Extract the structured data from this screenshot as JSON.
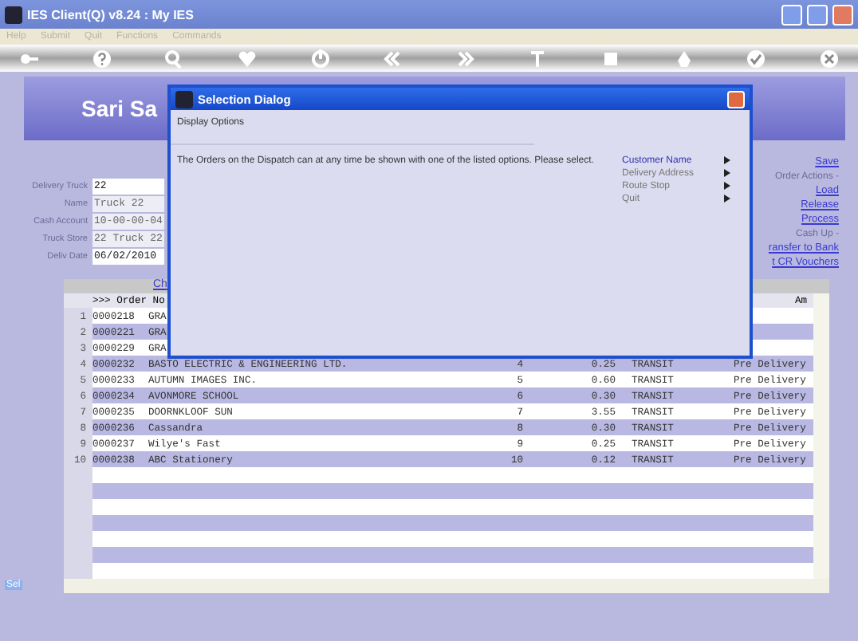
{
  "window": {
    "title": "IES Client(Q) v8.24 : My IES"
  },
  "menu": [
    "Help",
    "Submit",
    "Quit",
    "Functions",
    "Commands"
  ],
  "toolbar": [
    {
      "kind": "key"
    },
    {
      "kind": "help"
    },
    {
      "kind": "search"
    },
    {
      "kind": "heart"
    },
    {
      "kind": "power"
    },
    {
      "kind": "back"
    },
    {
      "kind": "forward"
    },
    {
      "kind": "text"
    },
    {
      "kind": "stop"
    },
    {
      "kind": "recycle"
    },
    {
      "kind": "check"
    },
    {
      "kind": "close"
    }
  ],
  "banner": {
    "title": "Sari Sa"
  },
  "form": [
    {
      "label": "Delivery Truck",
      "value": "22",
      "editable": true
    },
    {
      "label": "Name",
      "value": "Truck 22",
      "editable": false
    },
    {
      "label": "Cash Account",
      "value": "10-00-00-04",
      "editable": false
    },
    {
      "label": "Truck Store",
      "value": "22 Truck 22",
      "editable": false
    },
    {
      "label": "Deliv Date",
      "value": "06/02/2010",
      "editable": true
    }
  ],
  "actions": [
    {
      "kind": "link",
      "text": "Save"
    },
    {
      "kind": "heading",
      "text": "Order Actions -"
    },
    {
      "kind": "link",
      "text": "Load"
    },
    {
      "kind": "link",
      "text": "Release"
    },
    {
      "kind": "link",
      "text": "Process"
    },
    {
      "kind": "heading",
      "text": "Cash Up -"
    },
    {
      "kind": "link",
      "text": "ransfer to Bank"
    },
    {
      "kind": "link",
      "text": "t CR Vouchers"
    }
  ],
  "table": {
    "caption": "Ch",
    "columns": [
      ">>> Order No",
      "Am"
    ],
    "rows": [
      {
        "number": "1",
        "order_no": "0000218",
        "customer": "GRA",
        "column_4": "",
        "amount": "",
        "route": "",
        "status": ""
      },
      {
        "number": "2",
        "order_no": "0000221",
        "customer": "GRA",
        "column_4": "",
        "amount": "",
        "route": "",
        "status": ""
      },
      {
        "number": "3",
        "order_no": "0000229",
        "customer": "GRA",
        "column_4": "",
        "amount": "",
        "route": "",
        "status": ""
      },
      {
        "number": "4",
        "order_no": "0000232",
        "customer": "BASTO ELECTRIC & ENGINEERING LTD.",
        "column_4": "4",
        "amount": "0.25",
        "route": "TRANSIT",
        "status": "Pre Delivery"
      },
      {
        "number": "5",
        "order_no": "0000233",
        "customer": "AUTUMN IMAGES INC.",
        "column_4": "5",
        "amount": "0.60",
        "route": "TRANSIT",
        "status": "Pre Delivery"
      },
      {
        "number": "6",
        "order_no": "0000234",
        "customer": "AVONMORE SCHOOL",
        "column_4": "6",
        "amount": "0.30",
        "route": "TRANSIT",
        "status": "Pre Delivery"
      },
      {
        "number": "7",
        "order_no": "0000235",
        "customer": "DOORNKLOOF SUN",
        "column_4": "7",
        "amount": "3.55",
        "route": "TRANSIT",
        "status": "Pre Delivery"
      },
      {
        "number": "8",
        "order_no": "0000236",
        "customer": "Cassandra",
        "column_4": "8",
        "amount": "0.30",
        "route": "TRANSIT",
        "status": "Pre Delivery"
      },
      {
        "number": "9",
        "order_no": "0000237",
        "customer": "Wilye's Fast",
        "column_4": "9",
        "amount": "0.25",
        "route": "TRANSIT",
        "status": "Pre Delivery"
      },
      {
        "number": "10",
        "order_no": "0000238",
        "customer": "ABC Stationery",
        "column_4": "10",
        "amount": "0.12",
        "route": "TRANSIT",
        "status": "Pre Delivery"
      }
    ]
  },
  "side_tab": {
    "text": "Sel"
  },
  "dialog": {
    "title": "Selection Dialog",
    "heading": "Display Options",
    "message": "The Orders on the Dispatch can at any time be shown with one of the listed options. Please select.",
    "options": [
      {
        "label": "Customer Name",
        "selected": true
      },
      {
        "label": "Delivery Address",
        "selected": false
      },
      {
        "label": "Route Stop",
        "selected": false
      },
      {
        "label": "Quit",
        "selected": false
      }
    ]
  }
}
